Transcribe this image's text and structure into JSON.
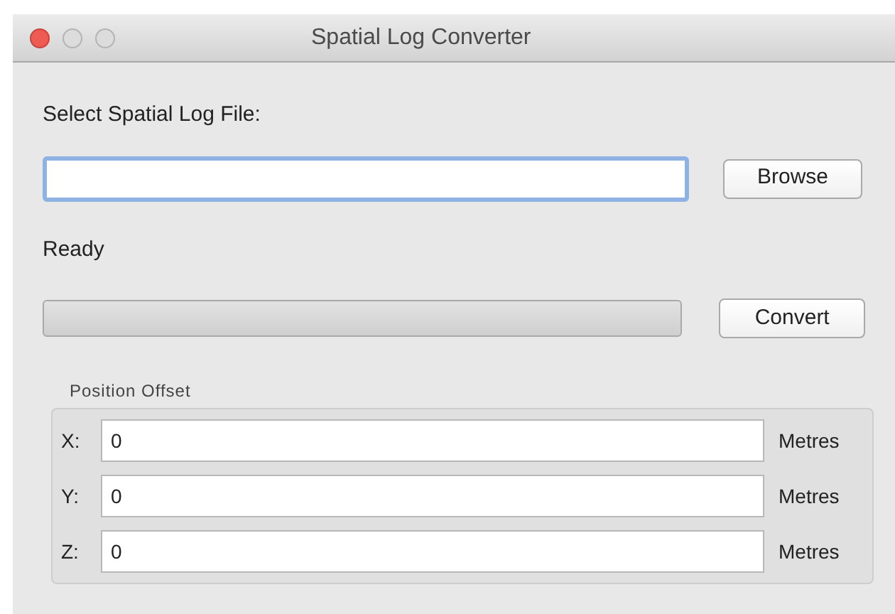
{
  "window": {
    "title": "Spatial Log Converter"
  },
  "file": {
    "label": "Select Spatial Log File:",
    "focused": true,
    "button": "Browse"
  },
  "status": "Ready",
  "progress": {
    "level": 0
  },
  "convert_button": "Convert",
  "offset": {
    "title": "Position Offset",
    "rows": [
      {
        "axis": "X:",
        "value": "0",
        "unit": "Metres"
      },
      {
        "axis": "Y:",
        "value": "0",
        "unit": "Metres"
      },
      {
        "axis": "Z:",
        "value": "0",
        "unit": "Metres"
      }
    ]
  }
}
